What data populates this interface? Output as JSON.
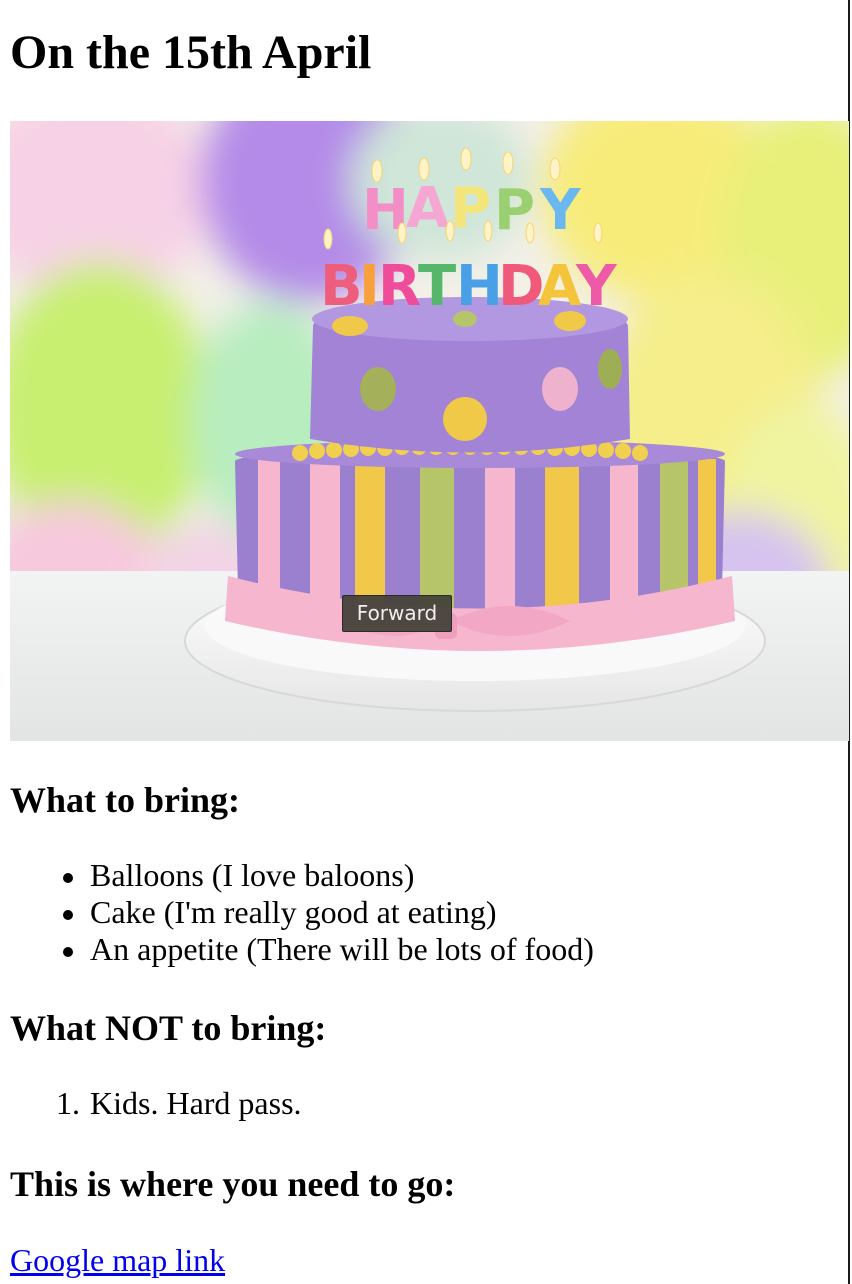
{
  "page": {
    "title": "On the 15th April",
    "tooltip": "Forward",
    "image": {
      "candle_letters": [
        "H",
        "A",
        "P",
        "P",
        "Y",
        "B",
        "I",
        "R",
        "T",
        "H",
        "D",
        "A",
        "Y"
      ],
      "colors": {
        "balloon_purple": "#b48be8",
        "balloon_green": "#c8ef70",
        "balloon_yellow": "#f7ec7a",
        "balloon_pink": "#f7c9dd",
        "cake_purple": "#9b80d0",
        "cake_pink": "#f6b6cd",
        "cake_yellow": "#f1c84a",
        "cake_green": "#b6c56a"
      }
    }
  },
  "sections": {
    "bring": {
      "heading": "What to bring:",
      "items": [
        "Balloons (I love baloons)",
        "Cake (I'm really good at eating)",
        "An appetite (There will be lots of food)"
      ]
    },
    "not_bring": {
      "heading": "What NOT to bring:",
      "items": [
        {
          "number": "1.",
          "text": "Kids. Hard pass."
        }
      ]
    },
    "where": {
      "heading": "This is where you need to go:",
      "link_text": "Google map link"
    }
  }
}
